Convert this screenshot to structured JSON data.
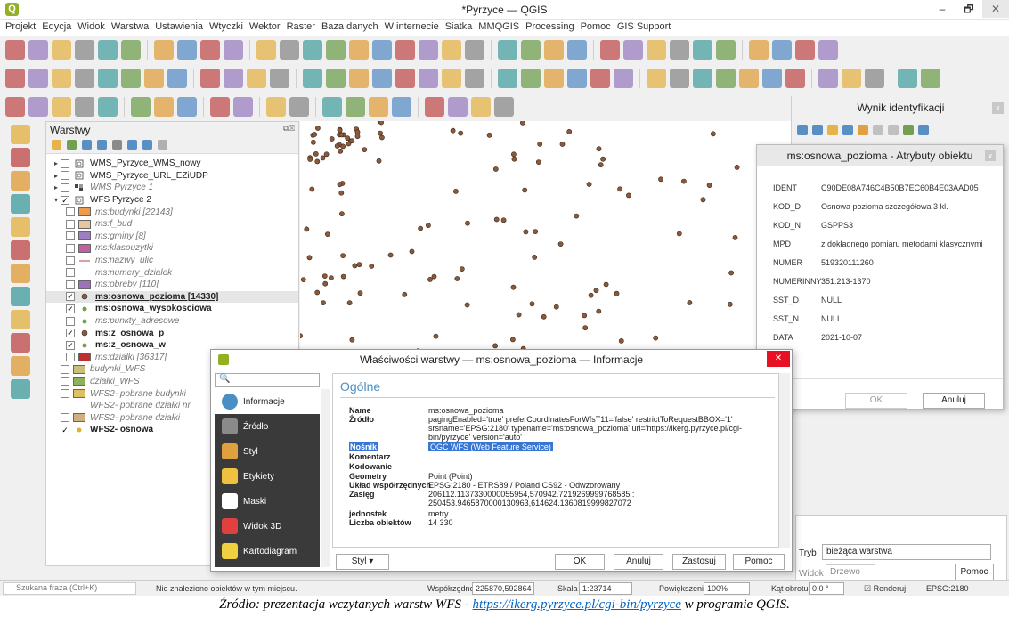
{
  "window": {
    "title": "*Pyrzyce — QGIS",
    "app_logo": "Q",
    "minimize": "–",
    "maximize": "🗗",
    "close": "✕"
  },
  "menu": [
    "Projekt",
    "Edycja",
    "Widok",
    "Warstwa",
    "Ustawienia",
    "Wtyczki",
    "Wektor",
    "Raster",
    "Baza danych",
    "W internecie",
    "Siatka",
    "MMQGIS",
    "Processing",
    "Pomoc",
    "GIS Support"
  ],
  "layers_panel": {
    "title": "Warstwy",
    "items": [
      {
        "name": "WMS_Pyrzyce_WMS_nowy",
        "checked": false,
        "expand": "▸",
        "style": "normal",
        "symbol": "wms"
      },
      {
        "name": "WMS_Pyrzyce_URL_EZiUDP",
        "checked": false,
        "expand": "▸",
        "style": "normal",
        "symbol": "wms"
      },
      {
        "name": "WMS Pyrzyce 1",
        "checked": false,
        "expand": "▸",
        "style": "it",
        "symbol": "wms2"
      },
      {
        "name": "WFS Pyrzyce 2",
        "checked": true,
        "expand": "▾",
        "style": "normal",
        "symbol": "wms"
      },
      {
        "name": "ms:budynki [22143]",
        "checked": false,
        "style": "it",
        "symbol": "#ef9a4a"
      },
      {
        "name": "ms:f_bud",
        "checked": false,
        "style": "it",
        "symbol": "#e8c7a0"
      },
      {
        "name": "ms:gminy [8]",
        "checked": false,
        "style": "it",
        "symbol": "#9b7fc1"
      },
      {
        "name": "ms:klasouzytki",
        "checked": false,
        "style": "it",
        "symbol": "#c062a0"
      },
      {
        "name": "ms:nazwy_ulic",
        "checked": false,
        "style": "it",
        "symbol": "line"
      },
      {
        "name": "ms:numery_dzialek",
        "checked": false,
        "style": "it",
        "symbol": "none"
      },
      {
        "name": "ms:obreby [110]",
        "checked": false,
        "style": "it",
        "symbol": "#a070c0"
      },
      {
        "name": "ms:osnowa_pozioma [14330]",
        "checked": true,
        "style": "b",
        "symbol": "dot",
        "selected": true
      },
      {
        "name": "ms:osnowa_wysokosciowa",
        "checked": true,
        "style": "b",
        "symbol": "dotg"
      },
      {
        "name": "ms:punkty_adresowe",
        "checked": false,
        "style": "it",
        "symbol": "dotg"
      },
      {
        "name": "ms:z_osnowa_p",
        "checked": true,
        "style": "b",
        "symbol": "dot"
      },
      {
        "name": "ms:z_osnowa_w",
        "checked": true,
        "style": "b",
        "symbol": "dotg"
      },
      {
        "name": "ms:dzialki [36317]",
        "checked": false,
        "style": "it",
        "symbol": "#c03030"
      },
      {
        "name": "budynki_WFS",
        "checked": false,
        "style": "it",
        "symbol": "#c9c080"
      },
      {
        "name": "działki_WFS",
        "checked": false,
        "style": "it",
        "symbol": "#90b060"
      },
      {
        "name": "WFS2- pobrane budynki",
        "checked": false,
        "style": "it",
        "symbol": "#e0c060"
      },
      {
        "name": "WFS2- pobrane działki nr",
        "checked": false,
        "style": "it",
        "symbol": "none"
      },
      {
        "name": "WFS2- pobrane działki",
        "checked": false,
        "style": "it",
        "symbol": "#d0b080"
      },
      {
        "name": "WFS2- osnowa",
        "checked": true,
        "style": "b",
        "symbol": "doty"
      }
    ]
  },
  "ident_panel": {
    "title": "Wynik identyfikacji",
    "close": "x",
    "tryb_label": "Tryb",
    "tryb_value": "bieżąca warstwa",
    "widok_label": "Widok",
    "widok_value": "Drzewo",
    "help": "Pomoc"
  },
  "attr_dialog": {
    "title": "ms:osnowa_pozioma - Atrybuty obiektu",
    "close": "x",
    "rows": [
      {
        "key": "IDENT",
        "value": "C90DE08A746C4B50B7EC60B4E03AAD05"
      },
      {
        "key": "KOD_D",
        "value": "Osnowa pozioma szczegółowa 3 kl."
      },
      {
        "key": "KOD_N",
        "value": "GSPPS3"
      },
      {
        "key": "MPD",
        "value": "z dokładnego pomiaru metodami klasycznymi"
      },
      {
        "key": "NUMER",
        "value": "519320111260"
      },
      {
        "key": "NUMERINNY",
        "value": "351.213-1370"
      },
      {
        "key": "SST_D",
        "value": "NULL"
      },
      {
        "key": "SST_N",
        "value": "NULL"
      },
      {
        "key": "DATA",
        "value": "2021-10-07"
      }
    ],
    "ok": "OK",
    "cancel": "Anuluj"
  },
  "props_dialog": {
    "title": "Właściwości warstwy — ms:osnowa_pozioma — Informacje",
    "close": "✕",
    "nav": [
      {
        "label": "Informacje",
        "active": true,
        "color": "#4a8fc4"
      },
      {
        "label": "Źródło",
        "active": false,
        "color": "#8a8a8a"
      },
      {
        "label": "Styl",
        "active": false,
        "color": "#e0a040"
      },
      {
        "label": "Etykiety",
        "active": false,
        "color": "#f0c040"
      },
      {
        "label": "Maski",
        "active": false,
        "color": "#ffffff"
      },
      {
        "label": "Widok 3D",
        "active": false,
        "color": "#e04040"
      },
      {
        "label": "Kartodiagram",
        "active": false,
        "color": "#f0d040"
      }
    ],
    "section": "Ogólne",
    "fields": {
      "name_k": "Name",
      "name_v": "ms:osnowa_pozioma",
      "src_k": "Źródło",
      "src_v": "pagingEnabled='true' preferCoordinatesForWfsT11='false' restrictToRequestBBOX='1' srsname='EPSG:2180' typename='ms:osnowa_pozioma' url='https://ikerg.pyrzyce.pl/cgi-bin/pyrzyce' version='auto'",
      "nos_k": "Nośnik",
      "nos_v": "OGC WFS (Web Feature Service)",
      "kom_k": "Komentarz",
      "kod_k": "Kodowanie",
      "geo_k": "Geometry",
      "geo_v": "Point (Point)",
      "uk_k": "Układ współrzędnych",
      "uk_v": "EPSG:2180 - ETRS89 / Poland CS92 - Odwzorowany",
      "zas_k": "Zasięg",
      "zas_v": "206112.1137330000055954,570942.7219269999768585 : 250453.9465870000130963,614624.1360819999827072",
      "jed_k": "jednostek",
      "jed_v": "metry",
      "lo_k": "Liczba obiektów",
      "lo_v": "14 330"
    },
    "buttons": {
      "styl": "Styl",
      "ok": "OK",
      "cancel": "Anuluj",
      "apply": "Zastosuj",
      "help": "Pomoc"
    }
  },
  "statusbar": {
    "search_placeholder": "Szukana fraza (Ctrl+K)",
    "message": "Nie znaleziono obiektów w tym miejscu.",
    "coord_label": "Współrzędne",
    "coord_value": "225870,592864",
    "scale_label": "Skala",
    "scale_value": "1:23714",
    "zoom_label": "Powiększenie",
    "zoom_value": "100%",
    "rot_label": "Kąt obrotu",
    "rot_value": "0,0 °",
    "render_label": "Renderuj",
    "crs": "EPSG:2180"
  },
  "caption": {
    "prefix": "Źródło: prezentacja wczytanych warstw WFS - ",
    "link": "https://ikerg.pyrzyce.pl/cgi-bin/pyrzyce",
    "suffix": " w programie QGIS."
  },
  "colors": {
    "point": "#8b5a3c",
    "accent": "#4a8fc4",
    "qgis": "#93b023",
    "close": "#e81123"
  }
}
